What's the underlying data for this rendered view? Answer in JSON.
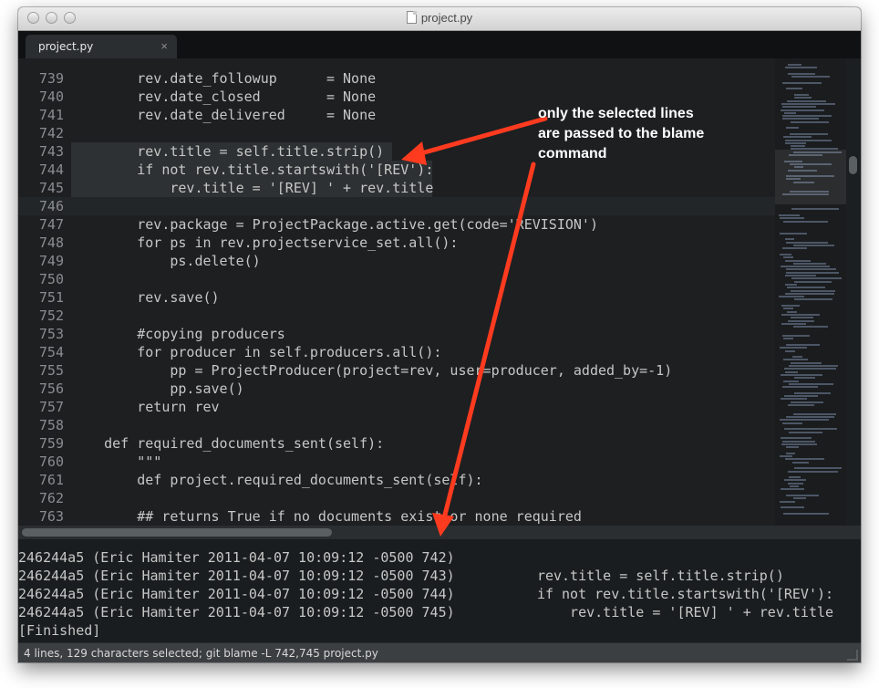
{
  "window": {
    "title": "project.py"
  },
  "tab": {
    "label": "project.py",
    "close_icon": "×"
  },
  "editor": {
    "lines": [
      {
        "num": "739",
        "text": "        rev.date_followup      = None"
      },
      {
        "num": "740",
        "text": "        rev.date_closed        = None"
      },
      {
        "num": "741",
        "text": "        rev.date_delivered     = None"
      },
      {
        "num": "742",
        "text": ""
      },
      {
        "num": "743",
        "text": "        rev.title = self.title.strip()"
      },
      {
        "num": "744",
        "text": "        if not rev.title.startswith('[REV'):"
      },
      {
        "num": "745",
        "text": "            rev.title = '[REV] ' + rev.title"
      },
      {
        "num": "746",
        "text": ""
      },
      {
        "num": "747",
        "text": "        rev.package = ProjectPackage.active.get(code='REVISION')"
      },
      {
        "num": "748",
        "text": "        for ps in rev.projectservice_set.all():"
      },
      {
        "num": "749",
        "text": "            ps.delete()"
      },
      {
        "num": "750",
        "text": ""
      },
      {
        "num": "751",
        "text": "        rev.save()"
      },
      {
        "num": "752",
        "text": ""
      },
      {
        "num": "753",
        "text": "        #copying producers"
      },
      {
        "num": "754",
        "text": "        for producer in self.producers.all():"
      },
      {
        "num": "755",
        "text": "            pp = ProjectProducer(project=rev, user=producer, added_by=-1)"
      },
      {
        "num": "756",
        "text": "            pp.save()"
      },
      {
        "num": "757",
        "text": "        return rev"
      },
      {
        "num": "758",
        "text": ""
      },
      {
        "num": "759",
        "text": "    def required_documents_sent(self):"
      },
      {
        "num": "760",
        "text": "        \"\"\""
      },
      {
        "num": "761",
        "text": "        def project.required_documents_sent(self):"
      },
      {
        "num": "762",
        "text": ""
      },
      {
        "num": "763",
        "text": "        ## returns True if no documents exist or none required"
      }
    ]
  },
  "output": {
    "lines": [
      "246244a5 (Eric Hamiter 2011-04-07 10:09:12 -0500 742)",
      "246244a5 (Eric Hamiter 2011-04-07 10:09:12 -0500 743)          rev.title = self.title.strip()",
      "246244a5 (Eric Hamiter 2011-04-07 10:09:12 -0500 744)          if not rev.title.startswith('[REV'):",
      "246244a5 (Eric Hamiter 2011-04-07 10:09:12 -0500 745)              rev.title = '[REV] ' + rev.title",
      "[Finished]"
    ]
  },
  "status": {
    "text": "4 lines, 129 characters selected; git blame -L 742,745 project.py"
  },
  "annotation": {
    "lines": [
      "only the selected lines",
      "are passed to the blame",
      "command"
    ]
  },
  "colors": {
    "arrow": "#ff3b1f",
    "editor_bg": "#1d1f21"
  }
}
